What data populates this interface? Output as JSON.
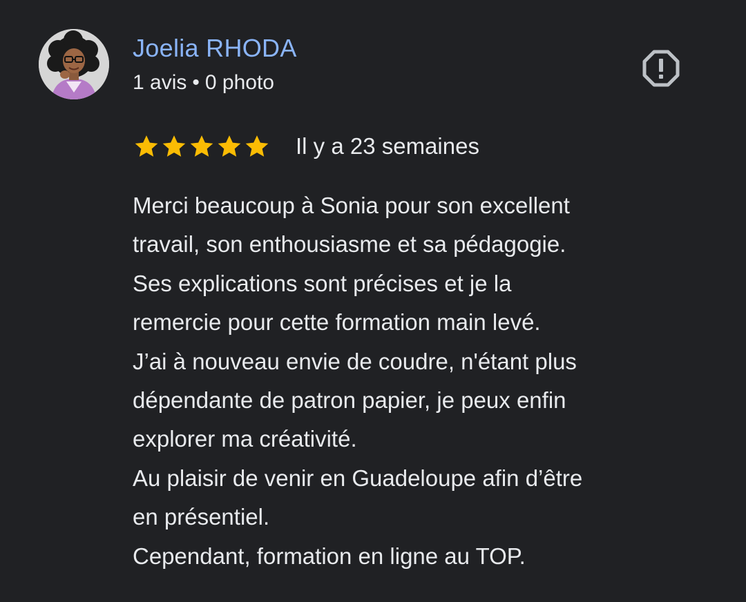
{
  "review": {
    "author": {
      "name": "Joelia RHODA",
      "reviews_count": "1 avis",
      "separator": "•",
      "photos_count": "0 photo"
    },
    "rating": {
      "value": 5,
      "max": 5
    },
    "date": "Il y a 23 semaines",
    "text_lines": [
      "Merci beaucoup à Sonia pour son excellent",
      "travail, son enthousiasme et sa pédagogie.",
      "Ses explications sont précises et je la",
      "remercie pour cette formation main levé.",
      "J’ai à nouveau envie de coudre, n'étant plus",
      "dépendante de patron papier, je peux enfin",
      "explorer ma créativité.",
      "Au plaisir de venir en Guadeloupe afin d’être",
      "en présentiel.",
      "Cependant, formation en ligne au TOP."
    ]
  },
  "icons": {
    "report": "report-octagon-icon",
    "star": "star-icon"
  },
  "colors": {
    "background": "#202124",
    "author_name": "#8ab4f8",
    "text": "#e8eaed",
    "star": "#fbbc04",
    "icon": "#bdc1c6"
  }
}
